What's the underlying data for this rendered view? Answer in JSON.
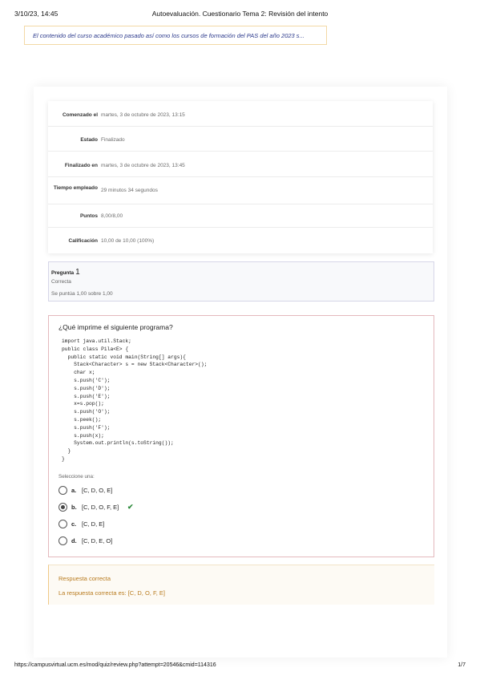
{
  "print_header": {
    "date": "3/10/23, 14:45",
    "title": "Autoevaluación. Cuestionario Tema 2: Revisión del intento"
  },
  "notice": {
    "text": "El contenido del curso académico pasado así como los cursos de formación del PAS del año 2023 s..."
  },
  "summary": {
    "rows": [
      {
        "label": "Comenzado el",
        "value": "martes, 3 de octubre de 2023, 13:15"
      },
      {
        "label": "Estado",
        "value": "Finalizado"
      },
      {
        "label": "Finalizado en",
        "value": "martes, 3 de octubre de 2023, 13:45"
      },
      {
        "label": "Tiempo empleado",
        "value": "29 minutos 34 segundos"
      },
      {
        "label": "Puntos",
        "value": "8,00/8,00"
      },
      {
        "label": "Calificación",
        "value": "10,00 de 10,00 (100%)"
      }
    ]
  },
  "question_info": {
    "label": "Pregunta",
    "number": "1",
    "state": "Correcta",
    "grade": "Se puntúa 1,00 sobre 1,00"
  },
  "question": {
    "text": "¿Qué imprime el siguiente programa?",
    "code_lines": [
      "import java.util.Stack;",
      "public class Pila<E> {",
      "  public static void main(String[] args){",
      "    Stack<Character> s = new Stack<Character>();",
      "    char x;",
      "    s.push('C');",
      "    s.push('D');",
      "    s.push('E');",
      "    x=s.pop();",
      "    s.push('O');",
      "    s.peek();",
      "    s.push('F');",
      "    s.push(x);",
      "    System.out.println(s.toString());",
      "  }",
      "}"
    ],
    "select_one": "Seleccione una:",
    "options": [
      {
        "letter": "a.",
        "text": "[C, D, O, E]",
        "selected": false,
        "correct": false
      },
      {
        "letter": "b.",
        "text": "[C, D, O, F, E]",
        "selected": true,
        "correct": true
      },
      {
        "letter": "c.",
        "text": "[C, D, E]",
        "selected": false,
        "correct": false
      },
      {
        "letter": "d.",
        "text": "[C, D, E, O]",
        "selected": false,
        "correct": false
      }
    ],
    "check_icon": "check-icon"
  },
  "feedback": {
    "title": "Respuesta correcta",
    "text": "La respuesta correcta es: [C, D, O, F, E]"
  },
  "print_footer": {
    "url": "https://campusvirtual.ucm.es/mod/quiz/review.php?attempt=20546&cmid=114316",
    "page": "1/7"
  },
  "colors": {
    "notice_border": "#f3d9a6",
    "notice_text": "#2c3a8c",
    "question_border": "#e4b9bd",
    "feedback_text": "#b87a1d",
    "correct_green": "#2e8b3d"
  }
}
